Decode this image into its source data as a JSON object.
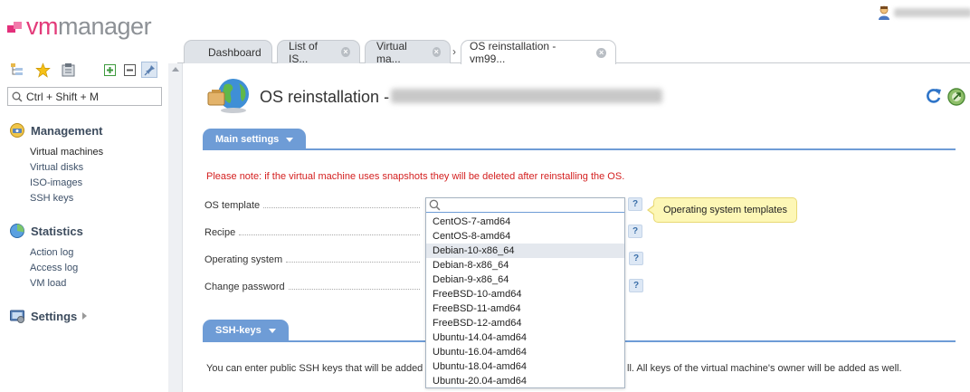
{
  "brand": {
    "part1": "vm",
    "part2": "manager",
    "accent": "#e33b7a"
  },
  "tabs": [
    {
      "label": "Dashboard",
      "closable": false
    },
    {
      "label": "List of IS...",
      "closable": true
    },
    {
      "label": "Virtual ma...",
      "closable": true
    },
    {
      "label": "OS reinstallation - vm99...",
      "closable": true,
      "active": true
    }
  ],
  "sidebar": {
    "search_placeholder": "Ctrl + Shift + M",
    "sections": [
      {
        "title": "Management",
        "icon": "management-icon",
        "items": [
          "Virtual machines",
          "Virtual disks",
          "ISO-images",
          "SSH keys"
        ]
      },
      {
        "title": "Statistics",
        "icon": "statistics-icon",
        "items": [
          "Action log",
          "Access log",
          "VM load"
        ]
      },
      {
        "title": "Settings",
        "icon": "settings-icon",
        "items": []
      }
    ]
  },
  "page": {
    "title": "OS reinstallation -",
    "main_tab": "Main settings",
    "ssh_tab": "SSH-keys",
    "note": "Please note: if the virtual machine uses snapshots they will be deleted after reinstalling the OS.",
    "fields": [
      "OS template",
      "Recipe",
      "Operating system",
      "Change password"
    ],
    "tooltip": "Operating system templates",
    "ssh_text_left": "You can enter public SSH keys that will be added",
    "ssh_text_right": "ll. All keys of the virtual machine's owner will be added as well."
  },
  "os_templates": {
    "search_value": "",
    "options": [
      "CentOS-7-amd64",
      "CentOS-8-amd64",
      "Debian-10-x86_64",
      "Debian-8-x86_64",
      "Debian-9-x86_64",
      "FreeBSD-10-amd64",
      "FreeBSD-11-amd64",
      "FreeBSD-12-amd64",
      "Ubuntu-14.04-amd64",
      "Ubuntu-16.04-amd64",
      "Ubuntu-18.04-amd64",
      "Ubuntu-20.04-amd64"
    ],
    "highlighted": "Debian-10-x86_64"
  },
  "colors": {
    "panel_blue": "#6e9cd6",
    "note_red": "#d42020",
    "tooltip_bg": "#fdf7b6"
  }
}
